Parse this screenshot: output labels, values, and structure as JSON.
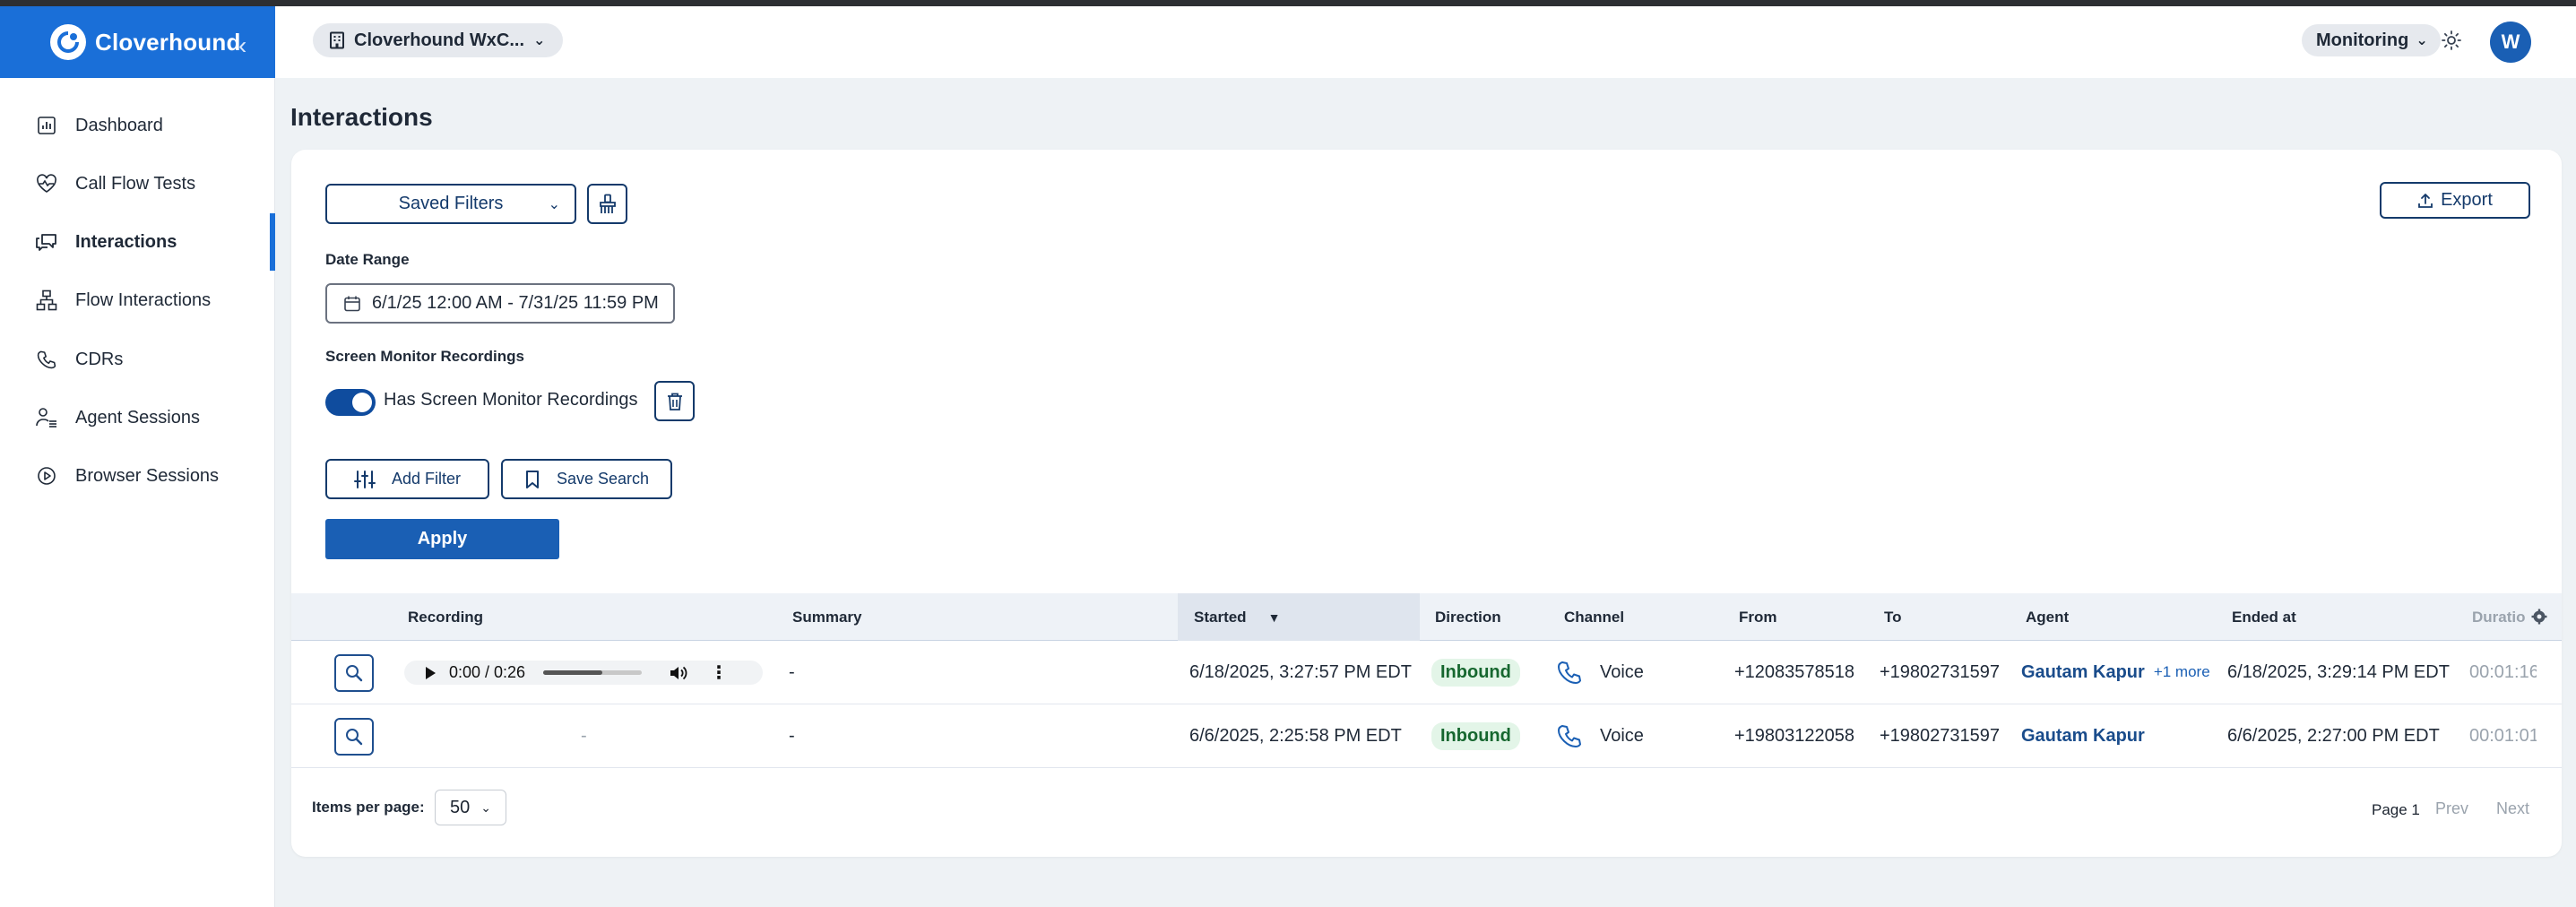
{
  "app": {
    "name": "Cloverhound",
    "collapse_icon": "chevron-left-icon"
  },
  "sidebar": {
    "items": [
      {
        "label": "Dashboard",
        "icon": "bar-chart-icon",
        "active": false
      },
      {
        "label": "Call Flow Tests",
        "icon": "heartbeat-icon",
        "active": false
      },
      {
        "label": "Interactions",
        "icon": "chat-bubbles-icon",
        "active": true
      },
      {
        "label": "Flow Interactions",
        "icon": "flow-chart-icon",
        "active": false
      },
      {
        "label": "CDRs",
        "icon": "phone-icon",
        "active": false
      },
      {
        "label": "Agent Sessions",
        "icon": "agent-list-icon",
        "active": false
      },
      {
        "label": "Browser Sessions",
        "icon": "play-circle-icon",
        "active": false
      }
    ]
  },
  "header": {
    "org_selector": "Cloverhound WxC...",
    "mode_selector": "Monitoring",
    "avatar_initial": "W"
  },
  "page": {
    "title": "Interactions"
  },
  "filters": {
    "saved_filters_label": "Saved Filters",
    "export_label": "Export",
    "date_range_label": "Date Range",
    "date_range_value": "6/1/25 12:00 AM - 7/31/25 11:59 PM",
    "screen_monitor_label": "Screen Monitor Recordings",
    "screen_monitor_toggle_label": "Has Screen Monitor Recordings",
    "screen_monitor_toggle_on": true,
    "add_filter_label": "Add Filter",
    "save_search_label": "Save Search",
    "apply_label": "Apply"
  },
  "table": {
    "columns": {
      "recording": "Recording",
      "summary": "Summary",
      "started": "Started",
      "direction": "Direction",
      "channel": "Channel",
      "from": "From",
      "to": "To",
      "agent": "Agent",
      "ended_at": "Ended at",
      "duration": "Duratio"
    },
    "sorted_column": "started",
    "sort_arrow": "▼",
    "rows": [
      {
        "recording": {
          "has_audio": true,
          "time": "0:00 / 0:26",
          "progress": 0.6
        },
        "summary": "-",
        "started": "6/18/2025, 3:27:57 PM EDT",
        "direction": "Inbound",
        "channel": "Voice",
        "from": "+12083578518",
        "to": "+19802731597",
        "agent": "Gautam Kapur",
        "agent_more": "+1 more",
        "ended_at": "6/18/2025, 3:29:14 PM EDT",
        "duration": "00:01:16"
      },
      {
        "recording": {
          "has_audio": false,
          "placeholder": "-"
        },
        "summary": "-",
        "started": "6/6/2025, 2:25:58 PM EDT",
        "direction": "Inbound",
        "channel": "Voice",
        "from": "+19803122058",
        "to": "+19802731597",
        "agent": "Gautam Kapur",
        "agent_more": "",
        "ended_at": "6/6/2025, 2:27:00 PM EDT",
        "duration": "00:01:01"
      }
    ]
  },
  "pagination": {
    "items_per_page_label": "Items per page:",
    "items_per_page_value": "50",
    "page_label": "Page 1",
    "prev_label": "Prev",
    "next_label": "Next"
  },
  "colors": {
    "brand": "#1a6fd8",
    "primary_button": "#1a5fb4",
    "inbound_badge_bg": "#e3f5e8",
    "inbound_badge_text": "#16672f"
  }
}
